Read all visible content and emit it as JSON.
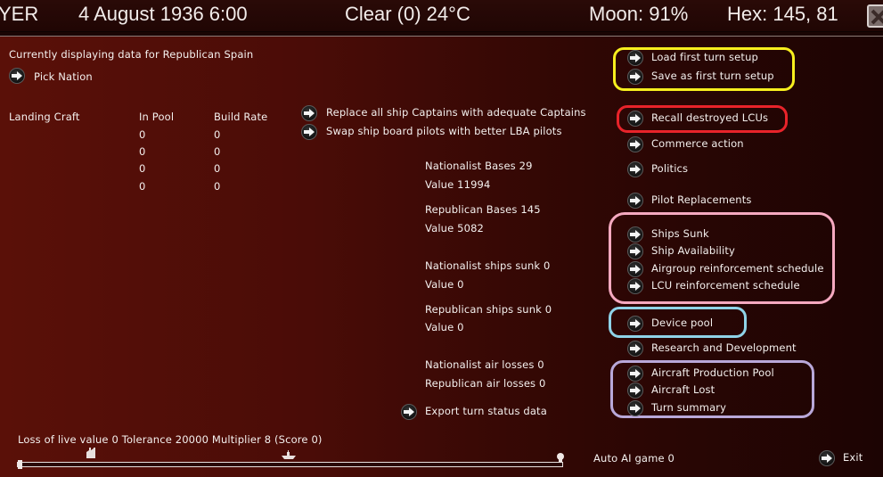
{
  "topbar": {
    "player": "YER",
    "date": "4 August 1936 6:00",
    "weather": "Clear (0) 24°C",
    "moon": "Moon: 91%",
    "hex": "Hex: 145, 81"
  },
  "header": {
    "currently_displaying": "Currently displaying data for Republican Spain",
    "pick_nation": "Pick Nation"
  },
  "pool_table": {
    "headers": [
      "Landing Craft",
      "In Pool",
      "Build Rate"
    ],
    "rows": [
      [
        "0",
        "0"
      ],
      [
        "0",
        "0"
      ],
      [
        "0",
        "0"
      ],
      [
        "0",
        "0"
      ]
    ]
  },
  "middle_actions": {
    "replace_captains": "Replace all ship Captains with adequate Captains",
    "swap_pilots": "Swap ship board pilots with better LBA pilots"
  },
  "stats": {
    "nationalist_bases": "Nationalist Bases 29",
    "nationalist_bases_value": "Value 11994",
    "republican_bases": "Republican Bases 145",
    "republican_bases_value": "Value 5082",
    "nationalist_ships_sunk": "Nationalist ships sunk 0",
    "nationalist_ships_value": "Value 0",
    "republican_ships_sunk": "Republican ships sunk 0",
    "republican_ships_value": "Value 0",
    "nationalist_air_losses": "Nationalist air losses 0",
    "republican_air_losses": "Republican air losses 0",
    "export": "Export turn status data"
  },
  "right_menu": {
    "load_first_turn": "Load first turn setup",
    "save_first_turn": "Save as first turn setup",
    "recall_lcus": "Recall destroyed LCUs",
    "commerce": "Commerce action",
    "politics": "Politics",
    "pilot_replacements": "Pilot Replacements",
    "ships_sunk": "Ships Sunk",
    "ship_availability": "Ship Availability",
    "airgroup_reinforcement": "Airgroup reinforcement schedule",
    "lcu_reinforcement": "LCU reinforcement schedule",
    "device_pool": "Device pool",
    "research": "Research and Development",
    "aircraft_production": "Aircraft Production Pool",
    "aircraft_lost": "Aircraft Lost",
    "turn_summary": "Turn summary"
  },
  "bottom": {
    "loss_value": "Loss of live value 0 Tolerance 20000 Multiplier 8 (Score 0)",
    "auto_ai": "Auto AI game 0",
    "exit": "Exit",
    "slider_value": 0
  },
  "highlight_colors": {
    "yellow": "#f7ef1e",
    "red": "#e8232a",
    "pink": "#f5a9c0",
    "cyan": "#8fd3e8",
    "lavender": "#b9a8d9"
  }
}
